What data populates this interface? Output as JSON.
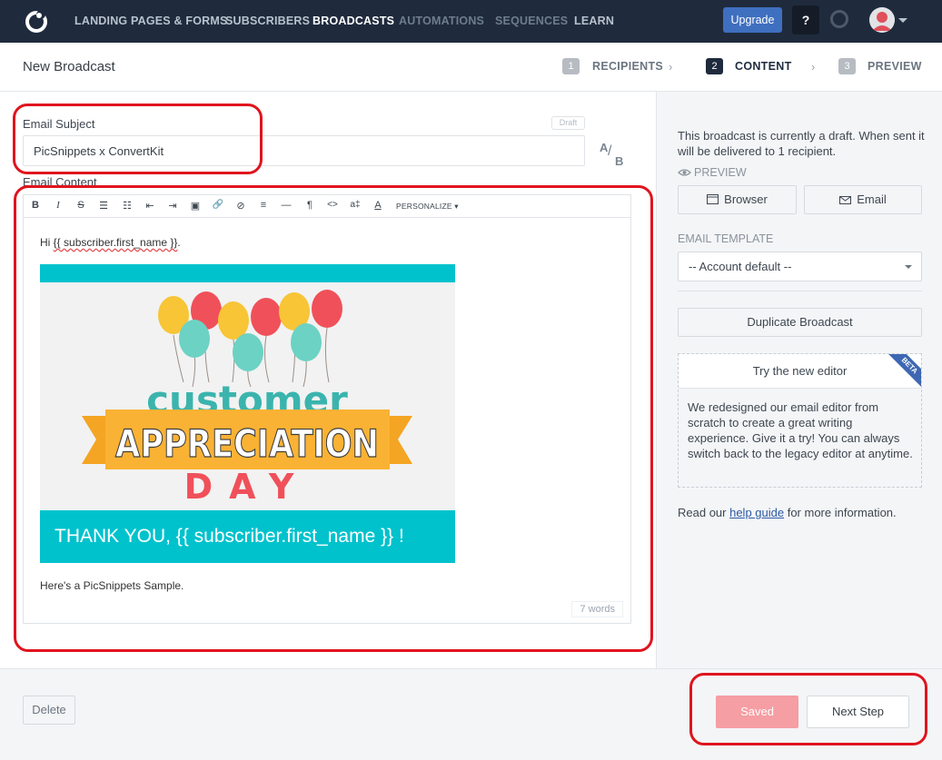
{
  "nav": {
    "items": [
      "LANDING PAGES & FORMS",
      "SUBSCRIBERS",
      "BROADCASTS",
      "AUTOMATIONS",
      "SEQUENCES",
      "LEARN"
    ],
    "upgrade": "Upgrade",
    "help": "?"
  },
  "header": {
    "title": "New Broadcast",
    "steps": [
      {
        "num": "1",
        "label": "RECIPIENTS"
      },
      {
        "num": "2",
        "label": "CONTENT"
      },
      {
        "num": "3",
        "label": "PREVIEW"
      }
    ],
    "chevron": "›"
  },
  "editor": {
    "subject_label": "Email Subject",
    "draft_badge": "Draft",
    "subject_value": "PicSnippets x ConvertKit",
    "ab": {
      "a": "A",
      "b": "B",
      "slash": "/"
    },
    "content_label": "Email Content",
    "toolbar": {
      "bold": "B",
      "italic": "I",
      "strike": "S",
      "ul": "☰",
      "ol": "☷",
      "outdent": "⇤",
      "indent": "⇥",
      "image": "▣",
      "link": "🔗",
      "unlink": "⊘",
      "align": "≡",
      "hr": "—",
      "para": "¶",
      "code": "<>",
      "textsize": "a‡",
      "color": "A",
      "personalize": "PERSONALIZE ▾"
    },
    "greeting_prefix": "Hi ",
    "greeting_var": "{{ subscriber.first_name }}",
    "greeting_suffix": ".",
    "banner": {
      "word1": "customer",
      "word2": "APPRECIATION",
      "word3": "DAY",
      "thanks": "THANK YOU,  {{ subscriber.first_name }} !"
    },
    "closing": "Here's a PicSnippets Sample.",
    "word_count": "7 words"
  },
  "sidebar": {
    "status": "This broadcast is currently a draft. When sent it will be delivered to 1 recipient.",
    "preview_label": "PREVIEW",
    "browser_btn": "Browser",
    "email_btn": "Email",
    "template_label": "EMAIL TEMPLATE",
    "template_value": "-- Account default --",
    "duplicate_btn": "Duplicate Broadcast",
    "new_editor_title": "Try the new editor",
    "beta": "BETA",
    "new_editor_text": "We redesigned our email editor from scratch to create a great writing experience. Give it a try! You can always switch back to the legacy editor at anytime.",
    "help_prefix": "Read our ",
    "help_link": "help guide",
    "help_suffix": " for more information."
  },
  "footer": {
    "delete": "Delete",
    "saved": "Saved",
    "next": "Next Step"
  },
  "colors": {
    "nav_bg": "#1f2b3d",
    "accent_blue": "#3f6fbf",
    "saved_pink": "#f59ea3",
    "banner_teal": "#00c2cd",
    "banner_orange": "#f4a523",
    "banner_red": "#f0505a",
    "annotation_red": "#e0141e"
  }
}
